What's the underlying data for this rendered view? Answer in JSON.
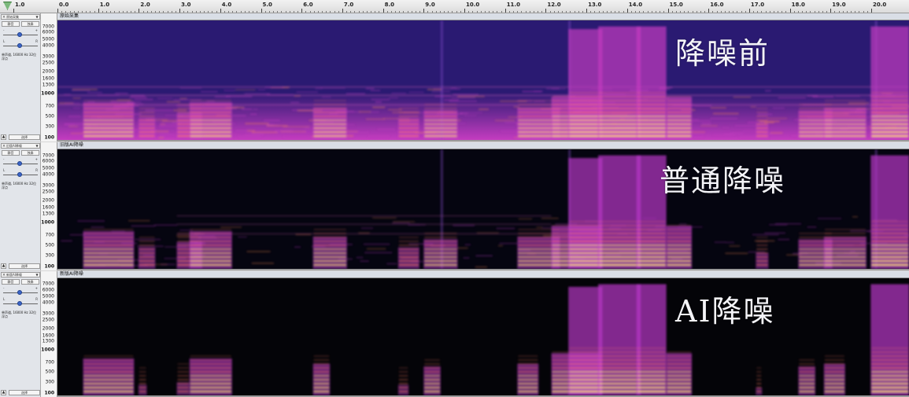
{
  "ruler": {
    "labels": [
      "1.0",
      "0.0",
      "1.0",
      "2.0",
      "3.0",
      "4.0",
      "5.0",
      "6.0",
      "7.0",
      "8.0",
      "9.0",
      "10.0",
      "11.0",
      "12.0",
      "13.0",
      "14.0",
      "15.0",
      "16.0",
      "17.0",
      "18.0",
      "19.0",
      "20.0"
    ],
    "start": -1.0,
    "end": 20.0
  },
  "freq_scale": {
    "labels": [
      "7000",
      "6000",
      "5000",
      "4000",
      "3000",
      "2500",
      "2000",
      "1600",
      "1300",
      "1000",
      "700",
      "500",
      "300",
      "100"
    ]
  },
  "tracks": [
    {
      "ctrl_name": "原始采集",
      "clip_title": "原始采集",
      "overlay": "降噪前",
      "mute_label": "静音",
      "solo_label": "独奏",
      "info": "单声道, 16000 Hz 32位 浮点",
      "select_label": "选择",
      "noise": 0.55,
      "colors": {
        "bg": "#2a1a72",
        "mid": "#c43cc0",
        "hot": "#ffd070"
      }
    },
    {
      "ctrl_name": "旧版AI降噪",
      "clip_title": "旧版AI降噪",
      "overlay": "普通降噪",
      "mute_label": "静音",
      "solo_label": "独奏",
      "info": "单声道, 16000 Hz 32位 浮点",
      "select_label": "选择",
      "noise": 0.25,
      "colors": {
        "bg": "#050510",
        "mid": "#b838c8",
        "hot": "#ffd070"
      }
    },
    {
      "ctrl_name": "新版AI降噪",
      "clip_title": "新版AI降噪",
      "overlay": "AI降噪",
      "mute_label": "静音",
      "solo_label": "独奏",
      "info": "单声道, 16000 Hz 32位 浮点",
      "select_label": "选择",
      "noise": 0.0,
      "colors": {
        "bg": "#040408",
        "mid": "#b838c8",
        "hot": "#ffd070"
      }
    }
  ],
  "icons": {
    "play_head": "triangle-down-icon",
    "close": "close-icon",
    "menu": "chevron-down-icon",
    "collapse": "triangle-up-icon"
  }
}
